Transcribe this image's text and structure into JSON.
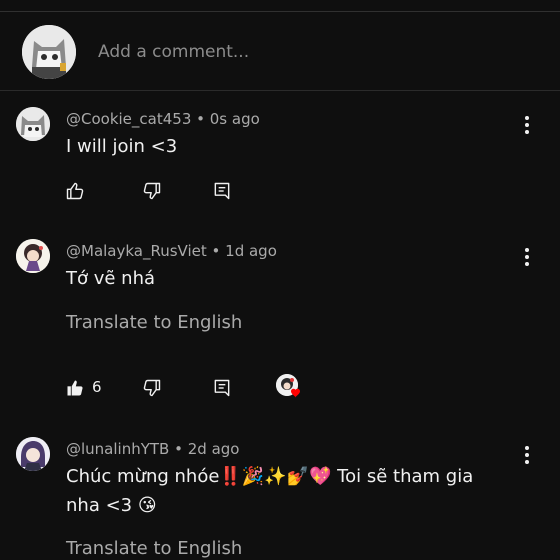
{
  "composer": {
    "placeholder": "Add a comment..."
  },
  "comments": [
    {
      "author": "@Cookie_cat453",
      "time": "0s ago",
      "text": "I will join <3",
      "likes": "",
      "translate_label": ""
    },
    {
      "author": "@Malayka_RusViet",
      "time": "1d ago",
      "text": "Tớ vẽ nhá",
      "likes": "6",
      "translate_label": "Translate to English",
      "creator_heart": true
    },
    {
      "author": "@lunalinhYTB",
      "time": "2d ago",
      "text_line1": "Chúc mừng nhóe‼️🎉✨💅💖 Toi sẽ tham gia",
      "text_line2": "nha <3 😘",
      "translate_label": "Translate to English"
    }
  ],
  "icons": {
    "like": "thumbs-up-icon",
    "dislike": "thumbs-down-icon",
    "reply": "reply-icon",
    "more": "more-vert-icon",
    "heart": "heart-icon"
  },
  "colors": {
    "background": "#0f0f0f",
    "text": "#f1f1f1",
    "secondary": "#aaaaaa",
    "heart": "#ff0000"
  },
  "separator": " • "
}
